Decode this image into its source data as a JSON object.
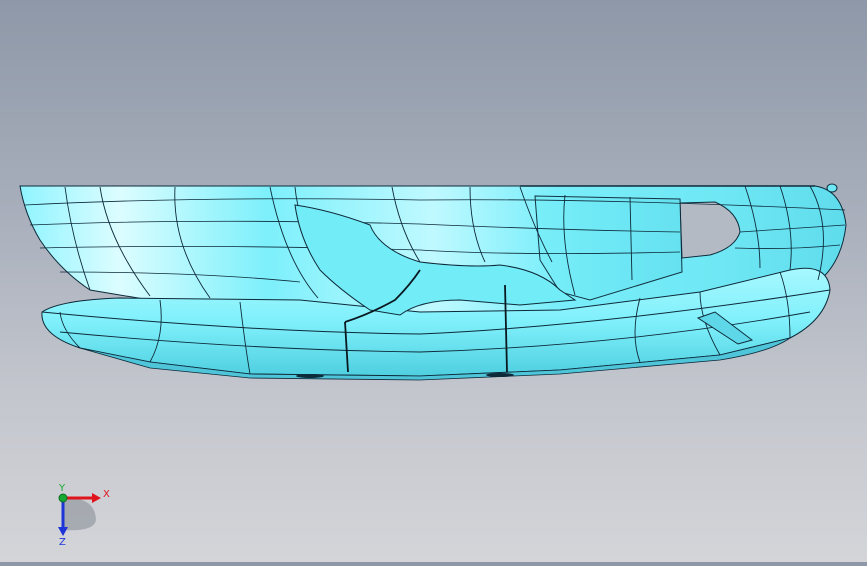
{
  "viewport": {
    "model": "boat-hull",
    "surface_color": "#7ff2ff",
    "edge_color": "#0d2a3a",
    "background_top": "#8e98a8",
    "background_bottom": "#d4d5d9"
  },
  "triad": {
    "x_label": "X",
    "y_label": "Y",
    "z_label": "Z",
    "x_color": "#e0141c",
    "y_color": "#16a832",
    "z_color": "#1c34d8"
  }
}
